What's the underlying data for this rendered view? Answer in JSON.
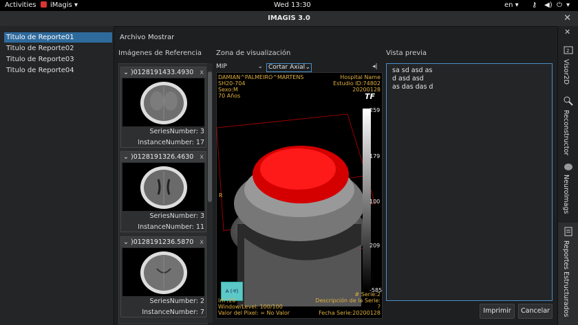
{
  "topbar": {
    "activities": "Activities",
    "app": "iMagis",
    "clock": "Wed 13:30",
    "lang": "en"
  },
  "window": {
    "title": "IMAGIS 3.0"
  },
  "reports": [
    "Titulo de Reporte01",
    "Titulo de Reporte02",
    "Titulo de Reporte03",
    "Titulo de Reporte04"
  ],
  "menu": {
    "file": "Archivo",
    "show": "Mostrar"
  },
  "labels": {
    "refs": "Imágenes de Referencia",
    "viz": "Zona de visualización",
    "preview": "Vista previa"
  },
  "refs": [
    {
      "title": ")0128191433.4930",
      "series": "SeriesNumber:  3",
      "instance": "InstanceNumber:  17"
    },
    {
      "title": ")0128191326.4630",
      "series": "SeriesNumber:  3",
      "instance": "InstanceNumber:  11"
    },
    {
      "title": ")0128191236.5870",
      "series": "SeriesNumber:  2",
      "instance": "InstanceNumber:  7"
    }
  ],
  "viewer": {
    "mode": "MIP",
    "cut": "Cortar Axial",
    "patient": "DAMIAN^PALMEIRO^MARTENS",
    "id": "SH20-704",
    "sex": "Sexo:M",
    "age": "70 Años",
    "hospital": "Hospital Name",
    "study": "Estudio ID:74802",
    "date": "20200128",
    "tf": "TF",
    "scale_top": "259",
    "scale_1": "179",
    "scale_2": "100",
    "scale_3": "209",
    "scale_bottom": "-585",
    "orient": "R",
    "cube": "A (-Y)",
    "img": "Im     /20",
    "wl": "Window/Level:  100/100",
    "px": "Valor del Pixel: = No Valor",
    "serie": "# Serie:2",
    "desc": "Descripción de la Serie:",
    "q": "?",
    "fecha": "Fecha Serie:20200128"
  },
  "preview": {
    "lines": [
      "sa sd asd as",
      "d asd asd",
      "as das das d"
    ]
  },
  "buttons": {
    "print": "Imprimir",
    "cancel": "Cancelar"
  },
  "tabs": {
    "visor": "Visor2D",
    "recon": "Reconstructor",
    "neuro": "NeuroImags",
    "reportes": "Reportes Estructurados"
  }
}
